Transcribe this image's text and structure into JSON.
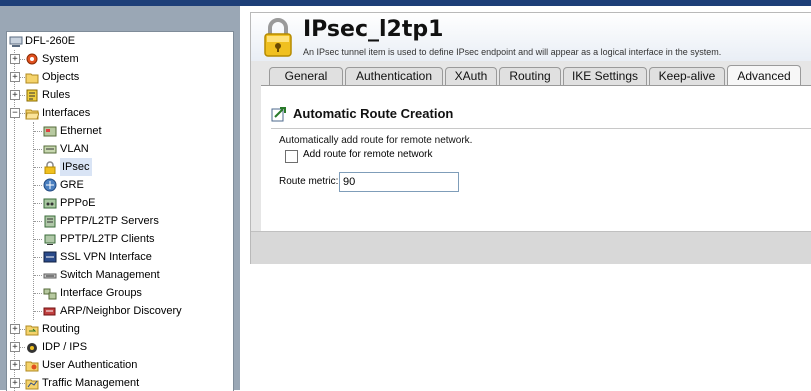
{
  "device": "DFL-260E",
  "tree": [
    {
      "label": "System",
      "expander": "+",
      "icon": "system-icon"
    },
    {
      "label": "Objects",
      "expander": "+",
      "icon": "folder-icon"
    },
    {
      "label": "Rules",
      "expander": "+",
      "icon": "rules-icon"
    },
    {
      "label": "Interfaces",
      "expander": "−",
      "icon": "folder-open-icon"
    },
    {
      "label": "Ethernet",
      "icon": "ethernet-icon"
    },
    {
      "label": "VLAN",
      "icon": "vlan-icon"
    },
    {
      "label": "IPsec",
      "icon": "lock-icon"
    },
    {
      "label": "GRE",
      "icon": "gre-icon"
    },
    {
      "label": "PPPoE",
      "icon": "pppoe-icon"
    },
    {
      "label": "PPTP/L2TP Servers",
      "icon": "server-icon"
    },
    {
      "label": "PPTP/L2TP Clients",
      "icon": "client-icon"
    },
    {
      "label": "SSL VPN Interface",
      "icon": "ssl-vpn-icon"
    },
    {
      "label": "Switch Management",
      "icon": "switch-icon"
    },
    {
      "label": "Interface Groups",
      "icon": "group-icon"
    },
    {
      "label": "ARP/Neighbor Discovery",
      "icon": "arp-icon"
    },
    {
      "label": "Routing",
      "expander": "+",
      "icon": "routing-icon"
    },
    {
      "label": "IDP / IPS",
      "expander": "+",
      "icon": "idp-icon"
    },
    {
      "label": "User Authentication",
      "expander": "+",
      "icon": "user-auth-icon"
    },
    {
      "label": "Traffic Management",
      "expander": "+",
      "icon": "traffic-icon"
    }
  ],
  "header": {
    "title": "IPsec_l2tp1",
    "subtitle": "An IPsec tunnel item is used to define IPsec endpoint and will appear as a logical interface in the system."
  },
  "tabs": [
    "General",
    "Authentication",
    "XAuth",
    "Routing",
    "IKE Settings",
    "Keep-alive",
    "Advanced"
  ],
  "active_tab": "Advanced",
  "section": {
    "title": "Automatic Route Creation",
    "description": "Automatically add route for remote network.",
    "checkbox_label": "Add route for remote network",
    "checkbox_checked": false,
    "metric_label": "Route metric:",
    "metric_value": "90"
  },
  "colors": {
    "topbar": "#1e3f78",
    "sidebar_bg": "#9aa7b5",
    "selection": "#d9e4f5"
  }
}
